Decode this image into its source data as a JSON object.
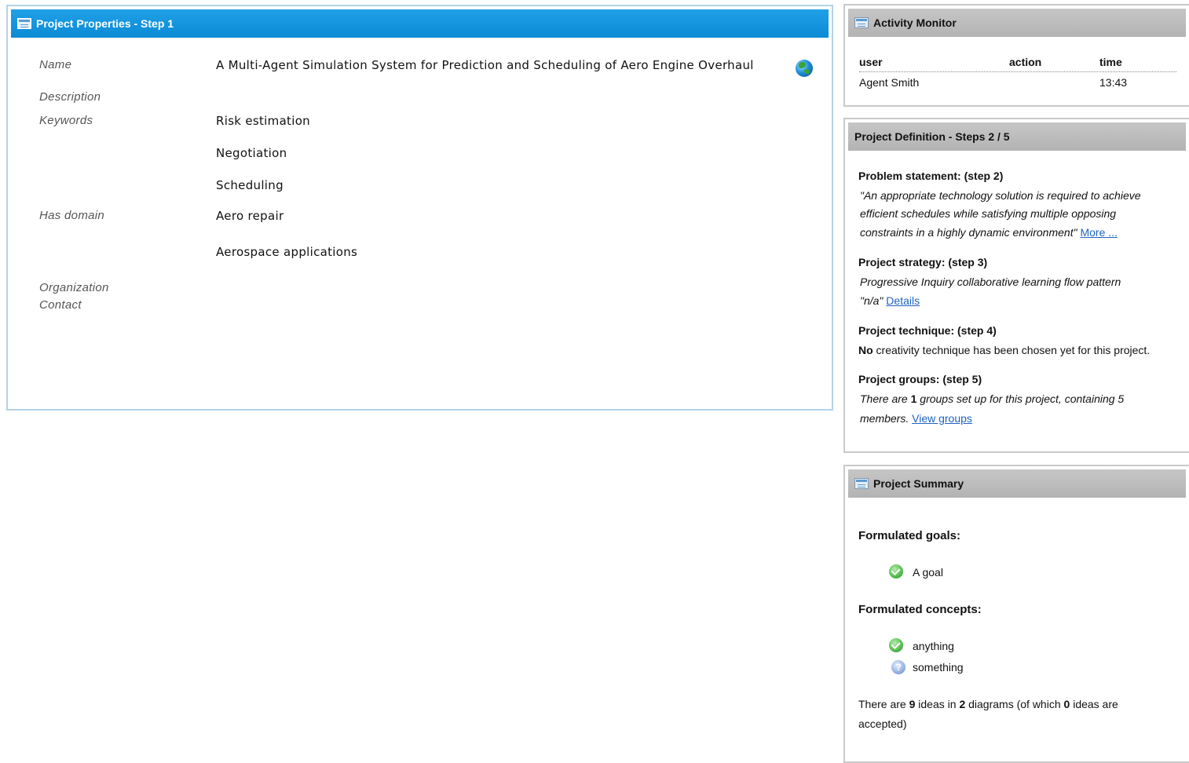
{
  "project_properties": {
    "title": "Project Properties - Step 1",
    "fields": {
      "name_label": "Name",
      "name_value": "A Multi-Agent Simulation System for Prediction and Scheduling of Aero Engine Overhaul",
      "description_label": "Description",
      "keywords_label": "Keywords",
      "keywords": [
        "Risk estimation",
        "Negotiation",
        "Scheduling"
      ],
      "has_domain_label": "Has domain",
      "domains": [
        "Aero repair",
        "Aerospace applications"
      ],
      "organization_label": "Organization",
      "contact_label": "Contact"
    }
  },
  "activity_monitor": {
    "title": "Activity Monitor",
    "columns": [
      "user",
      "action",
      "time"
    ],
    "rows": [
      {
        "user": "Agent Smith",
        "action": "",
        "time": "13:43"
      }
    ]
  },
  "project_definition": {
    "title": "Project Definition - Steps 2 / 5",
    "problem_statement": {
      "title": "Problem statement: (step 2)",
      "lines": [
        "\"An appropriate technology solution is required to achieve",
        "efficient schedules while satisfying multiple opposing",
        "constraints in a highly dynamic environment\""
      ],
      "link": "More ..."
    },
    "strategy": {
      "title": "Project strategy: (step 3)",
      "line1": "Progressive Inquiry collaborative learning flow pattern",
      "line2": "\"n/a\"",
      "link": "Details"
    },
    "technique": {
      "title": "Project technique: (step 4)",
      "bold": "No",
      "text": " creativity technique has been chosen yet for this project."
    },
    "groups": {
      "title": "Project groups: (step 5)",
      "line1_a": "There are ",
      "line1_b": "1",
      "line1_c": " groups set up for this project, containing 5",
      "line2": "members. ",
      "link": "View groups"
    }
  },
  "project_summary": {
    "title": "Project Summary",
    "goals_title": "Formulated goals:",
    "goals": [
      {
        "label": "A goal",
        "icon": "check-icon"
      }
    ],
    "concepts_title": "Formulated concepts:",
    "concepts": [
      {
        "label": "anything",
        "icon": "check-icon"
      },
      {
        "label": "something",
        "icon": "question-icon"
      }
    ],
    "ideas": {
      "a": "There are ",
      "n_ideas": "9",
      "b": " ideas in ",
      "n_diagrams": "2",
      "c": " diagrams (of which ",
      "n_accepted": "0",
      "d": " ideas are",
      "line2": "accepted)"
    }
  },
  "colors": {
    "header_blue": "#0c8bd6",
    "header_gray": "#b3b3b3",
    "link": "#1e63c0"
  }
}
